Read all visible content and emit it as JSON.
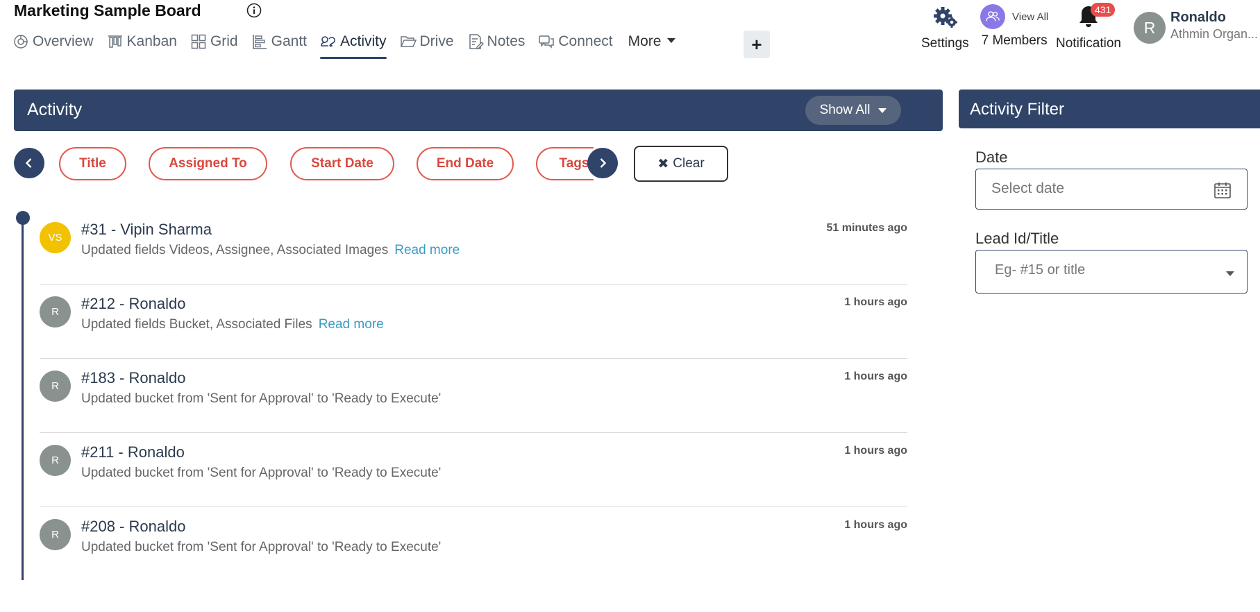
{
  "board": {
    "title": "Marketing Sample Board"
  },
  "nav": {
    "items": [
      {
        "label": "Overview",
        "icon": "overview-icon"
      },
      {
        "label": "Kanban",
        "icon": "kanban-icon"
      },
      {
        "label": "Grid",
        "icon": "grid-icon"
      },
      {
        "label": "Gantt",
        "icon": "gantt-icon"
      },
      {
        "label": "Activity",
        "icon": "activity-icon",
        "active": true
      },
      {
        "label": "Drive",
        "icon": "folder-icon"
      },
      {
        "label": "Notes",
        "icon": "notes-icon"
      },
      {
        "label": "Connect",
        "icon": "chat-icon"
      }
    ],
    "more_label": "More",
    "add_label": "+"
  },
  "header": {
    "settings_label": "Settings",
    "members_viewall": "View All",
    "members_label": "7 Members",
    "notification_label": "Notification",
    "notification_count": "431",
    "user": {
      "initial": "R",
      "name": "Ronaldo",
      "org": "Athmin Organ..."
    }
  },
  "activity": {
    "title": "Activity",
    "show_all": "Show All",
    "chips": [
      "Title",
      "Assigned To",
      "Start Date",
      "End Date",
      "Tags"
    ],
    "clear_label": "Clear",
    "entries": [
      {
        "initials": "VS",
        "color": "#f2c200",
        "title": "#31 - Vipin Sharma",
        "desc": "Updated fields Videos, Assignee, Associated Images",
        "read_more": "Read more",
        "time": "51 minutes ago"
      },
      {
        "initials": "R",
        "color": "#8a9290",
        "title": "#212 - Ronaldo",
        "desc": "Updated fields Bucket, Associated Files",
        "read_more": "Read more",
        "time": "1 hours ago"
      },
      {
        "initials": "R",
        "color": "#8a9290",
        "title": "#183 - Ronaldo",
        "desc": "Updated bucket from 'Sent for Approval' to 'Ready to Execute'",
        "read_more": "",
        "time": "1 hours ago"
      },
      {
        "initials": "R",
        "color": "#8a9290",
        "title": "#211 - Ronaldo",
        "desc": "Updated bucket from 'Sent for Approval' to 'Ready to Execute'",
        "read_more": "",
        "time": "1 hours ago"
      },
      {
        "initials": "R",
        "color": "#8a9290",
        "title": "#208 - Ronaldo",
        "desc": "Updated bucket from 'Sent for Approval' to 'Ready to Execute'",
        "read_more": "",
        "time": "1 hours ago"
      }
    ]
  },
  "filter": {
    "title": "Activity Filter",
    "date_label": "Date",
    "date_placeholder": "Select date",
    "lead_label": "Lead Id/Title",
    "lead_placeholder": "Eg- #15 or title"
  },
  "colors": {
    "primary": "#2f4468",
    "chip": "#e35a50",
    "link": "#3a9cc4",
    "badge": "#ea4b4b"
  }
}
